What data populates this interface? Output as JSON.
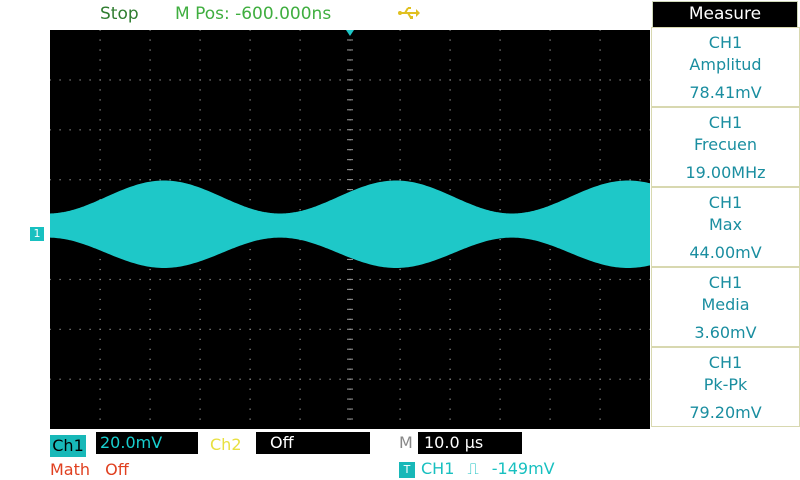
{
  "status": {
    "run_state": "Stop",
    "m_pos": "M Pos: -600.000ns"
  },
  "usb_icon": "usb-icon",
  "measure": {
    "title": "Measure",
    "items": [
      {
        "source": "CH1",
        "name": "Amplitud",
        "value": "78.41mV"
      },
      {
        "source": "CH1",
        "name": "Frecuen",
        "value": "19.00MHz"
      },
      {
        "source": "CH1",
        "name": "Max",
        "value": "44.00mV"
      },
      {
        "source": "CH1",
        "name": "Media",
        "value": "3.60mV"
      },
      {
        "source": "CH1",
        "name": "Pk-Pk",
        "value": "79.20mV"
      }
    ]
  },
  "bottom": {
    "ch1_label": "Ch1",
    "ch1_scale": "20.0mV",
    "ch2_label": "Ch2",
    "ch2_state": "Off",
    "m_label": "M",
    "timebase": "10.0 μs",
    "math_label": "Math",
    "math_state": "Off",
    "trigger_badge": "T",
    "trigger_source": "CH1",
    "trigger_slope": "⎍",
    "trigger_level": "-149mV"
  },
  "channel_marker": "1",
  "colors": {
    "trace": "#1ec8c8",
    "screen": "#000000",
    "grid": "#9a9a9a"
  }
}
